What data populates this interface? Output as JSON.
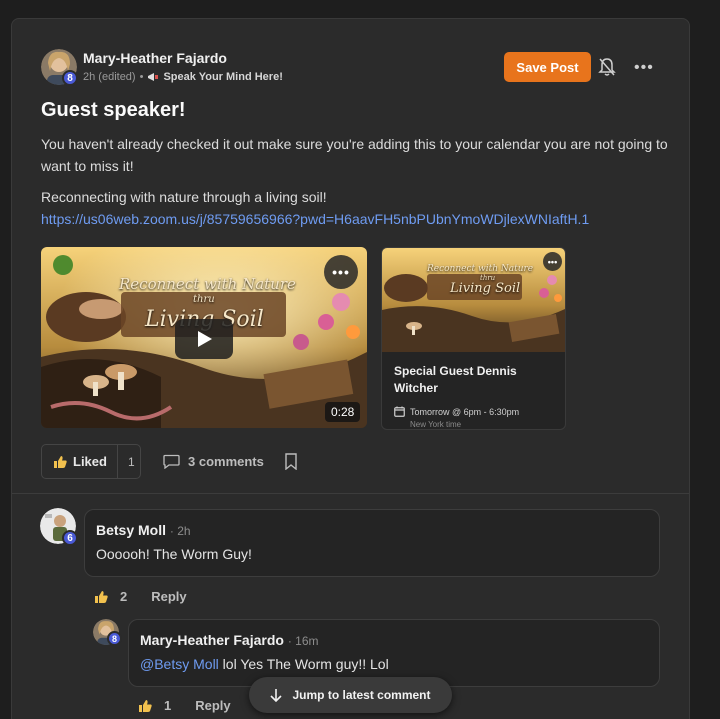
{
  "post": {
    "author": "Mary-Heather Fajardo",
    "author_level": "8",
    "time": "2h (edited)",
    "separator": "•",
    "category": "Speak Your Mind Here!",
    "save_label": "Save Post",
    "more_label": "•••",
    "title": "Guest speaker!",
    "body": "You haven't already checked it out make sure you're adding this to your calendar you are not going to want to miss it!",
    "paragraph2": "Reconnecting with nature through a living soil!",
    "link": "https://us06web.zoom.us/j/85759656966?pwd=H6aavFH5nbPUbnYmoWDjlexWNIaftH.1"
  },
  "video": {
    "thumb_line1": "Reconnect with Nature",
    "thumb_line2": "thru",
    "thumb_line3": "Living Soil",
    "duration": "0:28",
    "more_label": "•••"
  },
  "event": {
    "thumb_line1": "Reconnect with Nature",
    "thumb_line2": "thru",
    "thumb_line3": "Living Soil",
    "title": "Special Guest Dennis Witcher",
    "time": "Tomorrow @ 6pm - 6:30pm",
    "timezone": "New York time",
    "more_label": "•••"
  },
  "actions": {
    "liked_label": "Liked",
    "like_count": "1",
    "comments_label": "3 comments"
  },
  "comments": [
    {
      "author": "Betsy Moll",
      "time": "· 2h",
      "level": "6",
      "text": "Oooooh! The Worm Guy!",
      "likes": "2",
      "reply": "Reply"
    },
    {
      "author": "Mary-Heather Fajardo",
      "time": "· 16m",
      "level": "8",
      "mention": "@Betsy Moll",
      "text": " lol Yes The Worm guy!! Lol",
      "likes": "1",
      "reply": "Reply"
    }
  ],
  "jump_label": "Jump to latest comment",
  "colors": {
    "accent": "#e8741c",
    "link": "#6f9cf2",
    "level_badge": "#4a5ad6",
    "like_icon": "#f2c14e"
  }
}
